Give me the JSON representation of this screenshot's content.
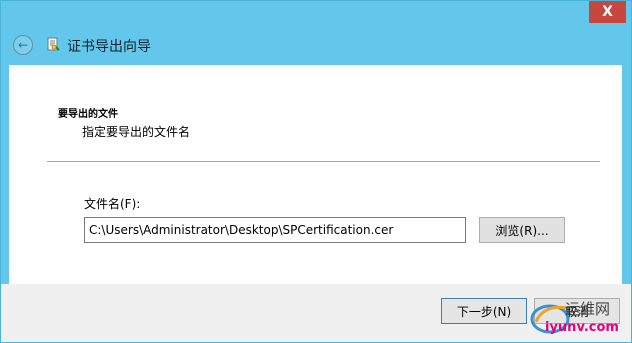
{
  "titlebar": {
    "close_label": "X"
  },
  "header": {
    "back_icon": "back-arrow-icon",
    "wizard_icon": "certificate-wizard-icon",
    "title": "证书导出向导"
  },
  "content": {
    "section_title": "要导出的文件",
    "section_subtitle": "指定要导出的文件名",
    "file_label": "文件名(F):",
    "file_value": "C:\\Users\\Administrator\\Desktop\\SPCertification.cer",
    "browse_label": "浏览(R)..."
  },
  "footer": {
    "next_label": "下一步(N)",
    "cancel_label": "取消"
  },
  "watermark": {
    "brand": "运维网",
    "domain": "iyunv.com"
  },
  "colors": {
    "titlebar": "#62c7ea",
    "close": "#c7463e",
    "footer": "#f0f0f0"
  }
}
